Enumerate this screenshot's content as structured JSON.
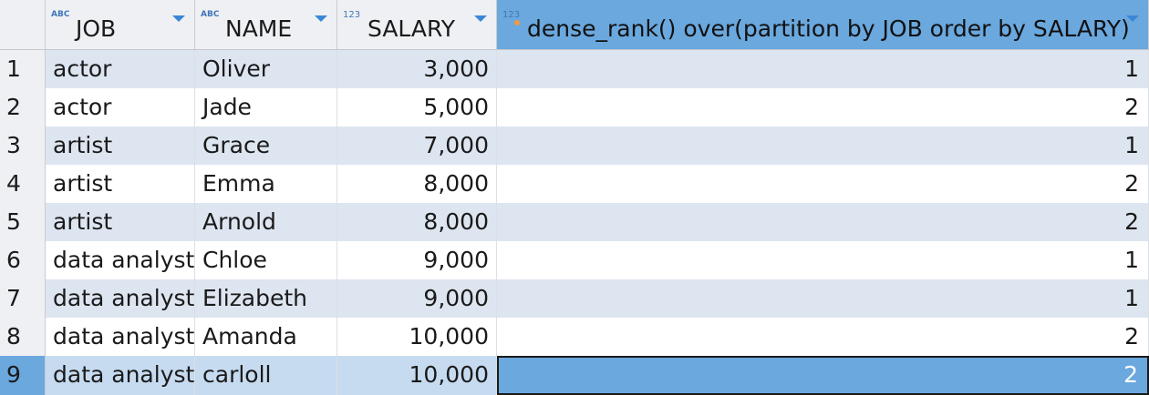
{
  "columns": [
    {
      "type_badge": "ABC",
      "label": "JOB"
    },
    {
      "type_badge": "ABC",
      "label": "NAME"
    },
    {
      "type_badge": "123",
      "label": "SALARY"
    },
    {
      "type_badge": "123",
      "label": "dense_rank() over(partition by JOB order by SALARY)"
    }
  ],
  "rows": [
    {
      "num": "1",
      "job": "actor",
      "name": "Oliver",
      "salary": "3,000",
      "rank": "1"
    },
    {
      "num": "2",
      "job": "actor",
      "name": "Jade",
      "salary": "5,000",
      "rank": "2"
    },
    {
      "num": "3",
      "job": "artist",
      "name": "Grace",
      "salary": "7,000",
      "rank": "1"
    },
    {
      "num": "4",
      "job": "artist",
      "name": "Emma",
      "salary": "8,000",
      "rank": "2"
    },
    {
      "num": "5",
      "job": "artist",
      "name": "Arnold",
      "salary": "8,000",
      "rank": "2"
    },
    {
      "num": "6",
      "job": "data analyst",
      "name": "Chloe",
      "salary": "9,000",
      "rank": "1"
    },
    {
      "num": "7",
      "job": "data analyst",
      "name": "Elizabeth",
      "salary": "9,000",
      "rank": "1"
    },
    {
      "num": "8",
      "job": "data analyst",
      "name": "Amanda",
      "salary": "10,000",
      "rank": "2"
    },
    {
      "num": "9",
      "job": "data analyst",
      "name": "carloll",
      "salary": "10,000",
      "rank": "2"
    }
  ],
  "selection": {
    "row": 9,
    "column": "dense_rank"
  },
  "colors": {
    "header_bg": "#eef0f3",
    "selected_header": "#6aa8de",
    "alt_row": "#dde5f0",
    "badge": "#3f76b8",
    "filter_arrow": "#3b87d6"
  },
  "icons": {
    "filter": "filter-arrow-icon",
    "type": "column-type-icon",
    "key": "computed-column-dot-icon"
  }
}
